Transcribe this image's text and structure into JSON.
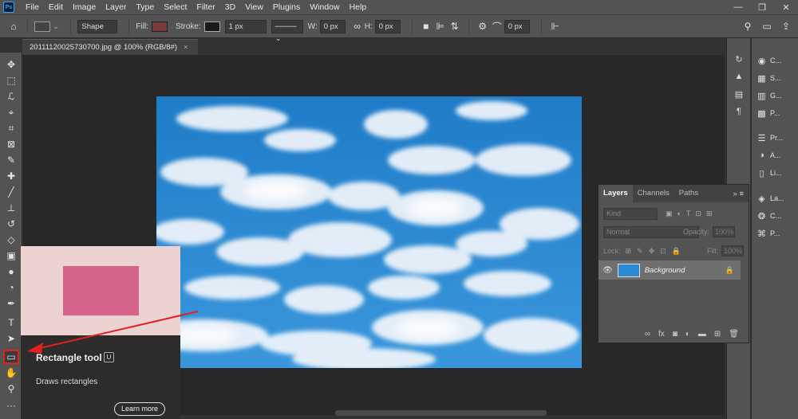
{
  "menu": {
    "logo": "Ps",
    "items": [
      "File",
      "Edit",
      "Image",
      "Layer",
      "Type",
      "Select",
      "Filter",
      "3D",
      "View",
      "Plugins",
      "Window",
      "Help"
    ],
    "window_controls": [
      "—",
      "❐",
      "✕"
    ]
  },
  "options": {
    "mode": "Shape",
    "fill_label": "Fill:",
    "fill_color": "#7a3a3a",
    "stroke_label": "Stroke:",
    "stroke_width": "1 px",
    "w_label": "W:",
    "w_value": "0 px",
    "h_label": "H:",
    "h_value": "0 px",
    "radius_value": "0 px"
  },
  "document": {
    "tab_title": "20111120025730700.jpg @ 100% (RGB/8#)",
    "close": "×"
  },
  "tools": [
    "move-tool-icon",
    "marquee-tool-icon",
    "lasso-tool-icon",
    "quick-select-icon",
    "crop-tool-icon",
    "frame-tool-icon",
    "eyedropper-icon",
    "healing-brush-icon",
    "brush-tool-icon",
    "clone-stamp-icon",
    "history-brush-icon",
    "eraser-icon",
    "gradient-tool-icon",
    "blur-tool-icon",
    "dodge-tool-icon",
    "pen-tool-icon",
    "type-tool-icon",
    "path-select-icon",
    "rectangle-tool-icon",
    "hand-tool-icon",
    "zoom-tool-icon",
    "more-tools-icon"
  ],
  "dock": {
    "items": [
      {
        "label": "C...",
        "icon": "color-icon"
      },
      {
        "label": "S...",
        "icon": "swatches-icon"
      },
      {
        "label": "G...",
        "icon": "gradients-icon"
      },
      {
        "label": "P...",
        "icon": "patterns-icon"
      },
      {
        "label": "Pr...",
        "icon": "properties-icon"
      },
      {
        "label": "A...",
        "icon": "adjustments-icon"
      },
      {
        "label": "Li...",
        "icon": "libraries-icon"
      },
      {
        "label": "La...",
        "icon": "layers-icon"
      },
      {
        "label": "C...",
        "icon": "channels-icon"
      },
      {
        "label": "P...",
        "icon": "paths-icon"
      }
    ]
  },
  "layers_panel": {
    "tabs": [
      "Layers",
      "Channels",
      "Paths"
    ],
    "active_tab": "Layers",
    "kind_placeholder": "Kind",
    "blend_mode": "Normal",
    "opacity_label": "Opacity:",
    "opacity_value": "100%",
    "lock_label": "Lock:",
    "fill_label": "Fill:",
    "fill_value": "100%",
    "layer_name": "Background"
  },
  "tooltip": {
    "title": "Rectangle tool",
    "shortcut": "U",
    "description": "Draws rectangles",
    "learn_more": "Learn more"
  },
  "colors": {
    "annotation_red": "#e32020",
    "sky_blue": "#2b8ad3",
    "preview_pink": "#d4628a"
  }
}
